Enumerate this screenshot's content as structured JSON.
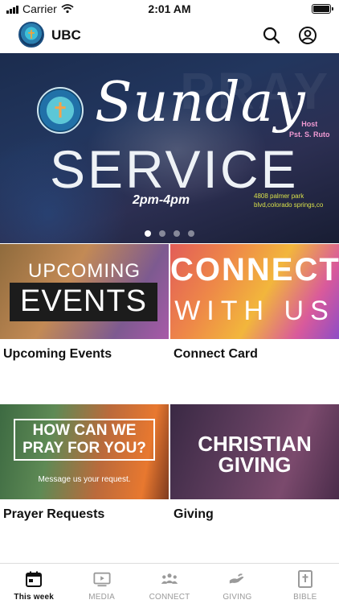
{
  "status_bar": {
    "carrier": "Carrier",
    "time": "2:01 AM"
  },
  "header": {
    "title": "UBC",
    "search_icon": "search-icon",
    "profile_icon": "account-circle-icon"
  },
  "hero": {
    "ghost_text": "PRAY",
    "script_title": "Sunday",
    "big_title": "SERVICE",
    "time": "2pm-4pm",
    "host_line1": "Host",
    "host_line2": "Pst. S. Ruto",
    "address_line1": "4808 palmer park",
    "address_line2": "blvd,colorado springs,co",
    "carousel_active_index": 0,
    "carousel_count": 4
  },
  "tiles": [
    {
      "label": "Upcoming Events",
      "art_line1": "UPCOMING",
      "art_line2": "EVENTS"
    },
    {
      "label": "Connect Card",
      "art_line1": "CONNECT",
      "art_line2": "WITH US"
    },
    {
      "label": "Prayer Requests",
      "art_line1": "HOW CAN WE PRAY FOR YOU?",
      "art_line2": "Message us your request."
    },
    {
      "label": "Giving",
      "art_line1": "CHRISTIAN GIVING"
    }
  ],
  "tab_bar": [
    {
      "label": "This week",
      "icon": "calendar-icon",
      "active": true
    },
    {
      "label": "MEDIA",
      "icon": "video-play-icon",
      "active": false
    },
    {
      "label": "CONNECT",
      "icon": "people-icon",
      "active": false
    },
    {
      "label": "GIVING",
      "icon": "giving-hand-icon",
      "active": false
    },
    {
      "label": "BIBLE",
      "icon": "bible-icon",
      "active": false
    }
  ],
  "colors": {
    "active_tab": "#111111",
    "inactive_tab": "#9a9a9a",
    "host_text": "#f09ad3",
    "address_text": "#d8e04a"
  }
}
